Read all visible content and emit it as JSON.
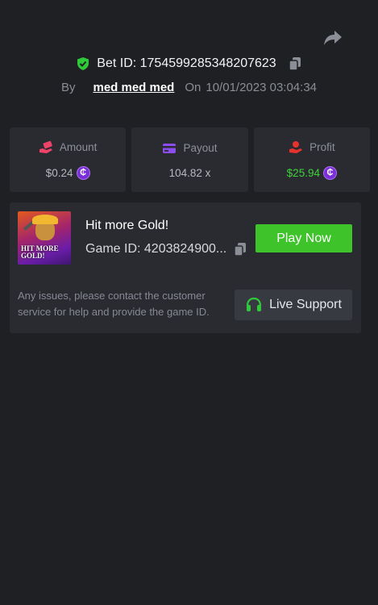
{
  "header": {
    "bet_id_label": "Bet ID: 1754599285348207623",
    "by_label": "By",
    "username": "med med med",
    "on_label": "On",
    "timestamp": "10/01/2023 03:04:34"
  },
  "stats": {
    "amount": {
      "label": "Amount",
      "value": "$0.24",
      "icon": "money-hand-icon"
    },
    "payout": {
      "label": "Payout",
      "value": "104.82 x",
      "icon": "card-icon"
    },
    "profit": {
      "label": "Profit",
      "value": "$25.94",
      "icon": "coin-hand-icon"
    },
    "coin_symbol": "₵"
  },
  "game": {
    "title": "Hit more Gold!",
    "id_label": "Game ID: 4203824900...",
    "thumb_text": "HIT MORE GOLD!",
    "play_label": "Play Now",
    "notice": "Any issues, please contact the customer service for help and provide the game ID.",
    "support_label": "Live Support"
  },
  "colors": {
    "background": "#1f2024",
    "card": "#2a2b31",
    "accent_green": "#3ec42a",
    "profit_green": "#3ed23a",
    "coin_purple": "#7b2fd8"
  }
}
